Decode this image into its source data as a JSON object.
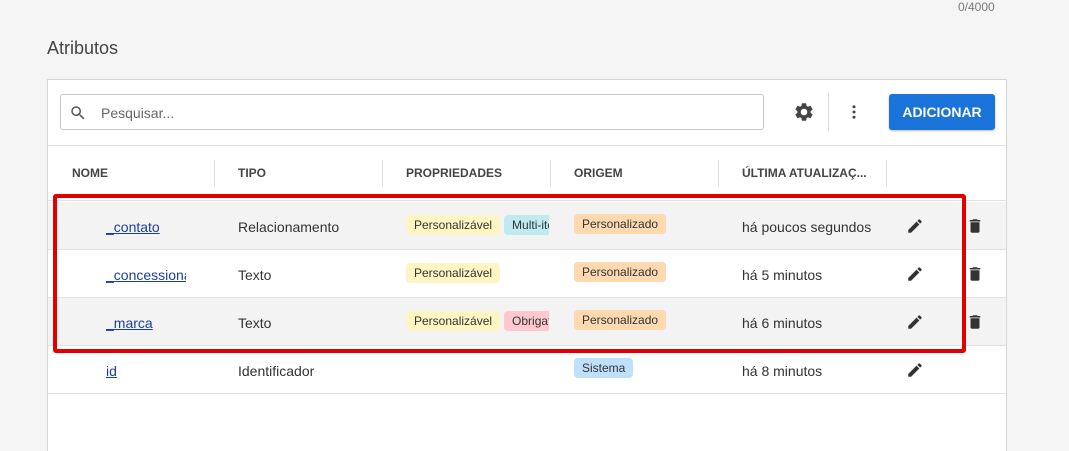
{
  "counter": "0/4000",
  "section_title": "Atributos",
  "toolbar": {
    "search_placeholder": "Pesquisar...",
    "search_icon": "search-icon",
    "settings_icon": "gear-icon",
    "more_icon": "more-vert-icon",
    "add_label": "ADICIONAR",
    "accent_color": "#1a73d9"
  },
  "table": {
    "columns": [
      "NOME",
      "TIPO",
      "PROPRIEDADES",
      "ORIGEM",
      "ÚLTIMA ATUALIZAÇ..."
    ],
    "rows": [
      {
        "name": "_contato",
        "type": "Relacionamento",
        "properties": [
          "Personalizável",
          "Multi-ite"
        ],
        "origin": "Personalizado",
        "updated": "há poucos segundos",
        "deletable": true
      },
      {
        "name": "_concessiona",
        "type": "Texto",
        "properties": [
          "Personalizável"
        ],
        "origin": "Personalizado",
        "updated": "há 5 minutos",
        "deletable": true
      },
      {
        "name": "_marca",
        "type": "Texto",
        "properties": [
          "Personalizável",
          "Obrigat"
        ],
        "origin": "Personalizado",
        "updated": "há 6 minutos",
        "deletable": true
      },
      {
        "name": "id",
        "type": "Identificador",
        "properties": [],
        "origin": "Sistema",
        "updated": "há 8 minutos",
        "deletable": false
      }
    ]
  },
  "highlight_color": "#e00000"
}
